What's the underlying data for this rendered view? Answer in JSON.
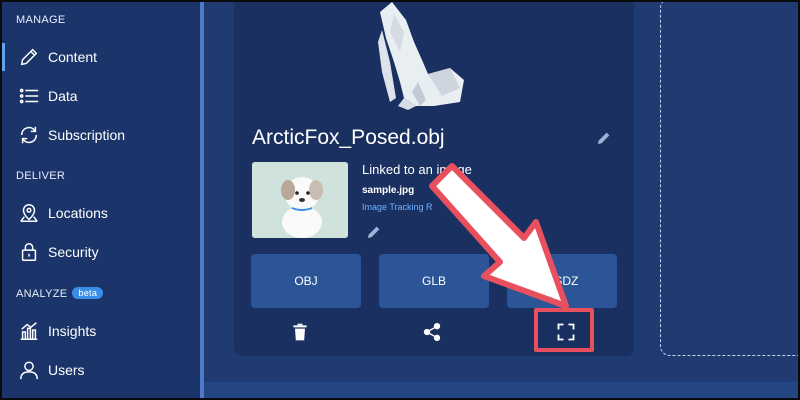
{
  "sidebar": {
    "manage_label": "MANAGE",
    "deliver_label": "DELIVER",
    "analyze_label": "ANALYZE",
    "beta_badge": "beta",
    "items": [
      {
        "label": "Content",
        "icon": "pencil-icon",
        "active": true
      },
      {
        "label": "Data",
        "icon": "list-icon"
      },
      {
        "label": "Subscription",
        "icon": "refresh-icon"
      },
      {
        "label": "Locations",
        "icon": "map-pin-icon"
      },
      {
        "label": "Security",
        "icon": "lock-icon"
      },
      {
        "label": "Insights",
        "icon": "bar-chart-icon"
      },
      {
        "label": "Users",
        "icon": "user-icon"
      }
    ]
  },
  "card": {
    "model_name": "ArcticFox_Posed.obj",
    "linked_title": "Linked to an image",
    "linked_file": "sample.jpg",
    "linked_type": "Image Tracking R",
    "format_buttons": [
      "OBJ",
      "GLB",
      "USDZ"
    ],
    "actions": [
      "trash-icon",
      "share-icon",
      "fullscreen-icon"
    ]
  },
  "colors": {
    "background": "#1f3b72",
    "sidebar": "#1b356a",
    "card": "#1a3060",
    "button": "#2c5598",
    "accent": "#3a8ee8",
    "highlight": "#e8505e"
  }
}
